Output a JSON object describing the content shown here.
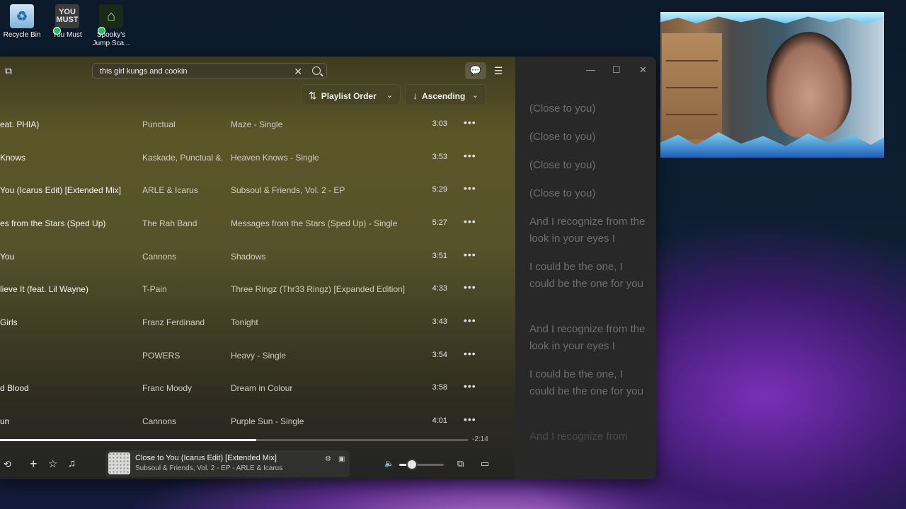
{
  "desktop": {
    "icons": [
      {
        "label": "Recycle Bin",
        "glyph": "♻"
      },
      {
        "label": "You Must",
        "glyph": "YOU MUST"
      },
      {
        "label": "Spooky's Jump Sca...",
        "glyph": "⌂"
      }
    ]
  },
  "search": {
    "value": "this girl kungs and cookin",
    "clear_glyph": "✕"
  },
  "sort": {
    "order_label": "Playlist Order",
    "direction_label": "Ascending"
  },
  "tracks": [
    {
      "title": "eat. PHIA)",
      "artist": "Punctual",
      "album": "Maze - Single",
      "duration": "3:03"
    },
    {
      "title": "Knows",
      "artist": "Kaskade, Punctual &...",
      "album": "Heaven Knows - Single",
      "duration": "3:53"
    },
    {
      "title": "You (Icarus Edit) [Extended Mix]",
      "artist": "ARLE & Icarus",
      "album": "Subsoul & Friends, Vol. 2 - EP",
      "duration": "5:29"
    },
    {
      "title": "es from the Stars (Sped Up)",
      "artist": "The Rah Band",
      "album": "Messages from the Stars (Sped Up) - Single",
      "duration": "5:27"
    },
    {
      "title": "You",
      "artist": "Cannons",
      "album": "Shadows",
      "duration": "3:51"
    },
    {
      "title": "lieve It (feat. Lil Wayne)",
      "artist": "T-Pain",
      "album": "Three Ringz (Thr33 Ringz) [Expanded Edition]",
      "duration": "4:33"
    },
    {
      "title": "Girls",
      "artist": "Franz Ferdinand",
      "album": "Tonight",
      "duration": "3:43"
    },
    {
      "title": "",
      "artist": "POWERS",
      "album": "Heavy - Single",
      "duration": "3:54"
    },
    {
      "title": "d Blood",
      "artist": "Franc Moody",
      "album": "Dream in Colour",
      "duration": "3:58"
    },
    {
      "title": "un",
      "artist": "Cannons",
      "album": "Purple Sun - Single",
      "duration": "4:01"
    }
  ],
  "player": {
    "progress": 0.547,
    "remaining": "-2:14",
    "volume": 0.28,
    "now_playing_title": "Close to You (Icarus Edit) [Extended Mix]",
    "now_playing_subtitle": "Subsoul & Friends, Vol. 2 - EP - ARLE & Icarus"
  },
  "lyrics": [
    "(Close to you)",
    "(Close to you)",
    "(Close to you)",
    "(Close to you)",
    "And I recognize from the look in your eyes I",
    "I could be the one, I could be the one for you",
    "And I recognize from the look in your eyes I",
    "I could be the one, I could be the one for you",
    "And I recognize from"
  ],
  "colors": {
    "accent": "#f2f2f2",
    "lyric_dim": "#6e6e6e",
    "main_tint": "#5b5628"
  }
}
